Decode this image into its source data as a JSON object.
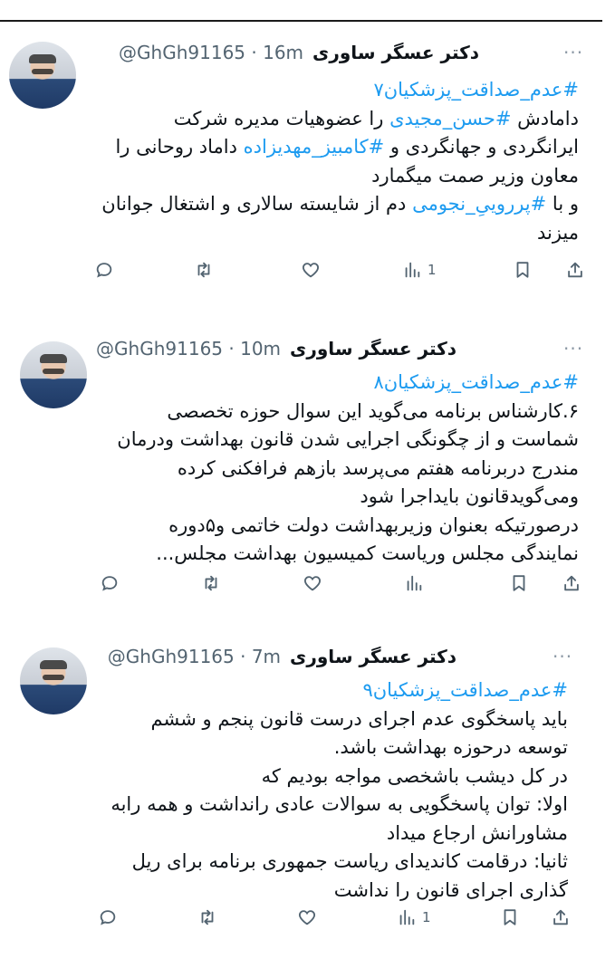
{
  "tweets": [
    {
      "name": "دکتر عسگر ساوری",
      "handle": "@GhGh91165 · 16m",
      "more": "···",
      "lines": [
        [
          {
            "t": "#عدم_صداقت_پزشکیان۷",
            "h": true
          }
        ],
        [
          {
            "t": "دامادش ",
            "h": false
          },
          {
            "t": "#حسن_مجیدی",
            "h": true
          },
          {
            "t": " را عضوهیات مدیره شرکت",
            "h": false
          }
        ],
        [
          {
            "t": "ایرانگردی و جهانگردی و ",
            "h": false
          },
          {
            "t": "#کامبیز_مهدیزاده",
            "h": true
          },
          {
            "t": " داماد روحانی را",
            "h": false
          }
        ],
        [
          {
            "t": "معاون وزیر صمت میگمارد",
            "h": false
          }
        ],
        [
          {
            "t": "و با ",
            "h": false
          },
          {
            "t": "#پرروییِ_نجومی",
            "h": true
          },
          {
            "t": " دم از شایسته سالاری و اشتغال جوانان",
            "h": false
          }
        ],
        [
          {
            "t": "میزند",
            "h": false
          }
        ]
      ],
      "views": "1"
    },
    {
      "name": "دکتر عسگر ساوری",
      "handle": "@GhGh91165 · 10m",
      "more": "···",
      "lines": [
        [
          {
            "t": "#عدم_صداقت_پزشکیان۸",
            "h": true
          }
        ],
        [
          {
            "t": "۶.کارشناس برنامه می‌گوید این سوال حوزه تخصصی",
            "h": false
          }
        ],
        [
          {
            "t": "شماست و از چگونگی اجرایی شدن قانون بهداشت ودرمان",
            "h": false
          }
        ],
        [
          {
            "t": "مندرج دربرنامه هفتم می‌پرسد بازهم فرافکنی کرده",
            "h": false
          }
        ],
        [
          {
            "t": "ومی‌گویدقانون بایداجرا شود",
            "h": false
          }
        ],
        [
          {
            "t": "درصورتیکه بعنوان وزیربهداشت دولت خاتمی و۵دوره",
            "h": false
          }
        ],
        [
          {
            "t": "نمایندگی مجلس وریاست کمیسیون بهداشت مجلس...",
            "h": false
          }
        ]
      ],
      "views": ""
    },
    {
      "name": "دکتر عسگر ساوری",
      "handle": "@GhGh91165 · 7m",
      "more": "···",
      "lines": [
        [
          {
            "t": "#عدم_صداقت_پزشکیان۹",
            "h": true
          }
        ],
        [
          {
            "t": "باید پاسخگوی عدم اجرای درست قانون پنجم و ششم",
            "h": false
          }
        ],
        [
          {
            "t": "توسعه درحوزه بهداشت باشد.",
            "h": false
          }
        ],
        [
          {
            "t": "در کل دیشب باشخصی مواجه بودیم که",
            "h": false
          }
        ],
        [
          {
            "t": "اولا: توان پاسخگویی به سوالات عادی رانداشت و همه رابه",
            "h": false
          }
        ],
        [
          {
            "t": "مشاورانش ارجاع میداد",
            "h": false
          }
        ],
        [
          {
            "t": "ثانیا: درقامت کاندیدای ریاست جمهوری برنامه برای ریل",
            "h": false
          }
        ],
        [
          {
            "t": "گذاری اجرای قانون را نداشت",
            "h": false
          }
        ]
      ],
      "views": "1"
    }
  ],
  "icons": [
    "reply-icon",
    "retweet-icon",
    "like-icon",
    "views-icon",
    "bookmark-icon",
    "share-icon"
  ],
  "colors": {
    "hashtag": "#1d9bf0",
    "secondary": "#536471",
    "text": "#0f1419"
  }
}
